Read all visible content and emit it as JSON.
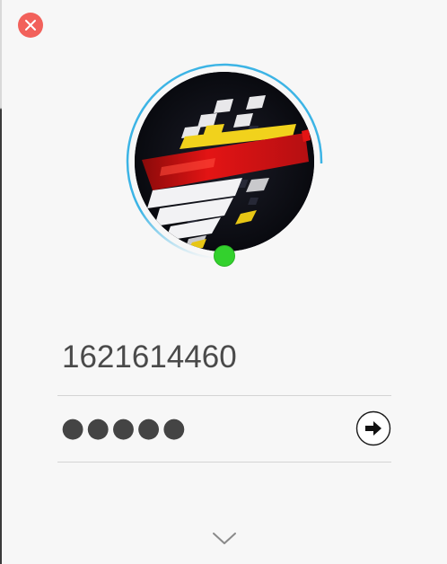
{
  "login": {
    "account": "1621614460",
    "password_mask": "●●●●●"
  },
  "icons": {
    "close": "close-icon",
    "submit": "arrow-right-icon",
    "expand": "chevron-down-icon",
    "status": "online-status-dot"
  },
  "colors": {
    "close": "#f2615b",
    "ring": "#3cb4e5",
    "status_online": "#33d12d",
    "text": "#4a4a4a",
    "divider": "#d4d4d4"
  }
}
